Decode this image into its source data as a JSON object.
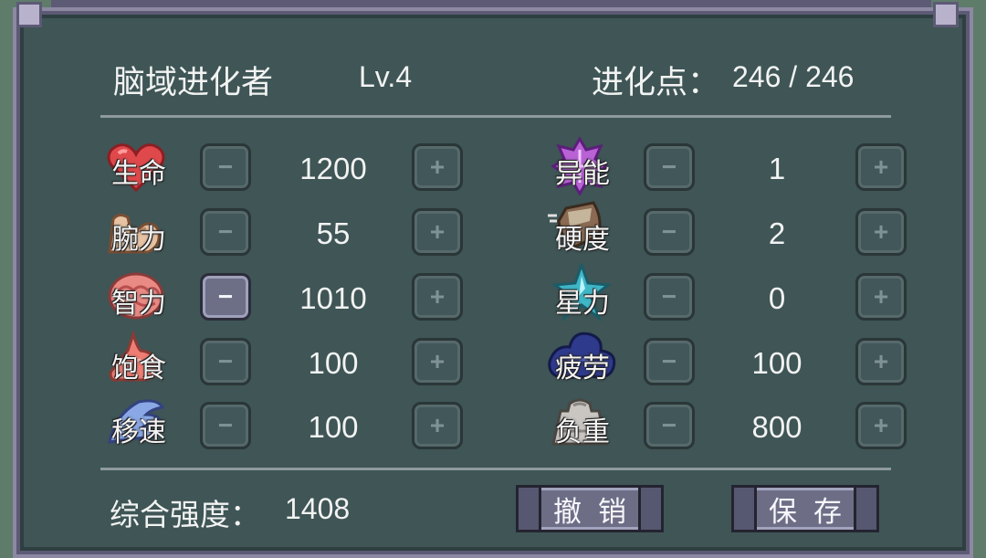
{
  "header": {
    "title": "脑域进化者",
    "level": "Lv.4",
    "points_label": "进化点：",
    "points_value": "246 / 246"
  },
  "stats_left": [
    {
      "label": "生命",
      "value": "1200",
      "icon": "heart-icon",
      "minus_active": false
    },
    {
      "label": "腕力",
      "value": "55",
      "icon": "arm-icon",
      "minus_active": false
    },
    {
      "label": "智力",
      "value": "1010",
      "icon": "brain-icon",
      "minus_active": true
    },
    {
      "label": "饱食",
      "value": "100",
      "icon": "drumstick-icon",
      "minus_active": false
    },
    {
      "label": "移速",
      "value": "100",
      "icon": "wing-icon",
      "minus_active": false
    }
  ],
  "stats_right": [
    {
      "label": "异能",
      "value": "1",
      "icon": "psi-icon",
      "minus_active": false
    },
    {
      "label": "硬度",
      "value": "2",
      "icon": "shield-icon",
      "minus_active": false
    },
    {
      "label": "星力",
      "value": "0",
      "icon": "star-icon",
      "minus_active": false
    },
    {
      "label": "疲劳",
      "value": "100",
      "icon": "fatigue-icon",
      "minus_active": false
    },
    {
      "label": "负重",
      "value": "800",
      "icon": "weight-icon",
      "minus_active": false
    }
  ],
  "button_symbols": {
    "minus": "−",
    "plus": "+"
  },
  "footer": {
    "strength_label": "综合强度：",
    "strength_value": "1408",
    "undo_label": "撤销",
    "save_label": "保存"
  }
}
